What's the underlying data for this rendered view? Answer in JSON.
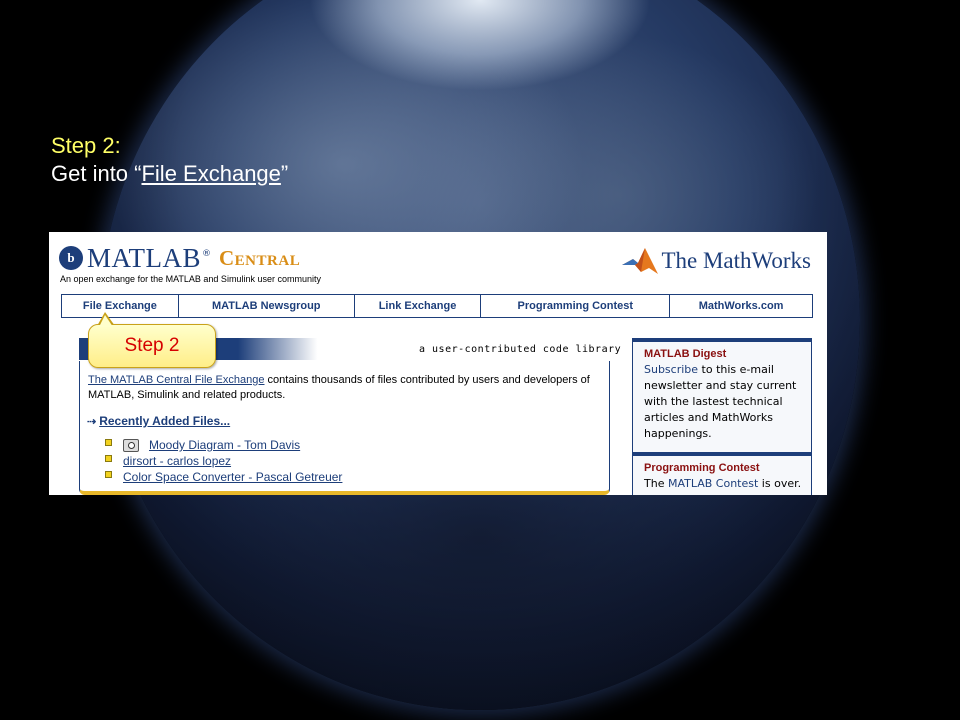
{
  "slide": {
    "title": "Step 2:",
    "body_prefix": "Get into “",
    "body_link": "File Exchange",
    "body_suffix": "”"
  },
  "header": {
    "logo_mark": "b",
    "logo_matlab": "MATLAB",
    "logo_reg": "®",
    "logo_central": "Central",
    "tagline": "An open exchange for the MATLAB and Simulink user community",
    "mathworks": "The MathWorks"
  },
  "nav": {
    "items": [
      {
        "label": "File Exchange"
      },
      {
        "label": "MATLAB Newsgroup"
      },
      {
        "label": "Link Exchange"
      },
      {
        "label": "Programming Contest"
      },
      {
        "label": "MathWorks.com"
      }
    ]
  },
  "callout": {
    "label": "Step 2"
  },
  "file_exchange": {
    "subtitle": "a user-contributed code library",
    "desc_link": "The MATLAB Central File Exchange",
    "desc_text": " contains thousands of files contributed by users and developers of MATLAB, Simulink and related products.",
    "recent_arrow": "⇢",
    "recent_label": "Recently Added Files...",
    "files": [
      {
        "label": "Moody Diagram - Tom Davis",
        "icon": "camera-icon"
      },
      {
        "label": "dirsort - carlos lopez",
        "icon": ""
      },
      {
        "label": "Color Space Converter - Pascal Getreuer",
        "icon": ""
      }
    ]
  },
  "sidebar": {
    "digest_title": "MATLAB Digest",
    "digest_link": "Subscribe",
    "digest_text": " to this e-mail newsletter and stay current with the lastest technical articles and MathWorks happenings.",
    "contest_title": "Programming Contest",
    "contest_prefix": "The ",
    "contest_link": "MATLAB Contest",
    "contest_suffix": " is over."
  },
  "colors": {
    "accent": "#1d3e7a",
    "central_orange": "#d98d16",
    "slide_title": "#ffff66",
    "callout_text": "#d60000"
  }
}
